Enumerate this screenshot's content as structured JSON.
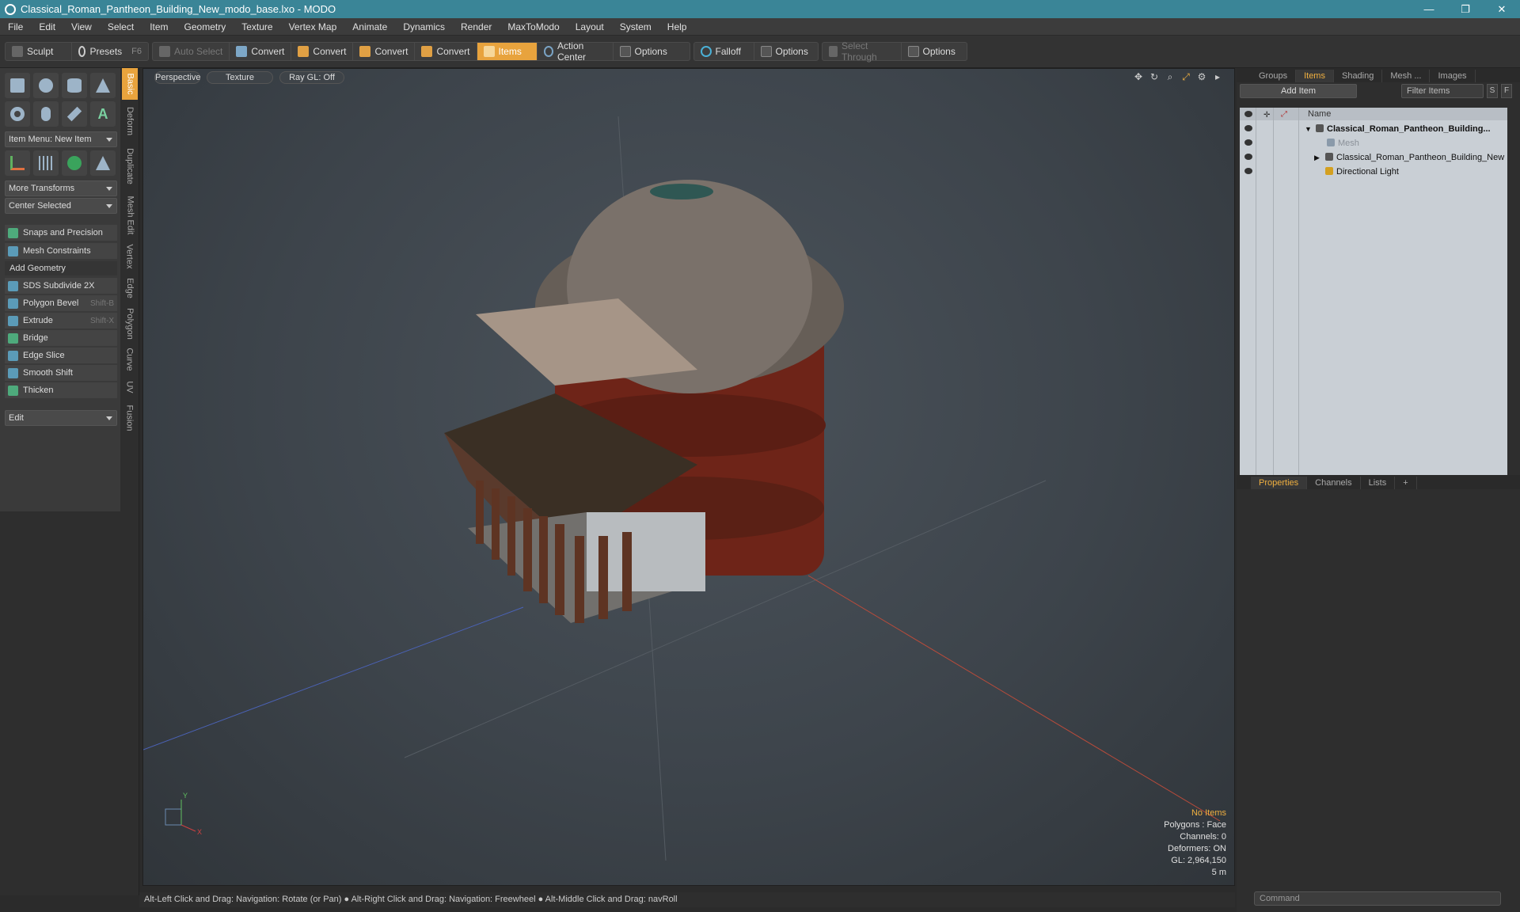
{
  "window": {
    "title": "Classical_Roman_Pantheon_Building_New_modo_base.lxo - MODO",
    "minimize": "—",
    "maximize": "❐",
    "close": "✕"
  },
  "menu": [
    "File",
    "Edit",
    "View",
    "Select",
    "Item",
    "Geometry",
    "Texture",
    "Vertex Map",
    "Animate",
    "Dynamics",
    "Render",
    "MaxToModo",
    "Layout",
    "System",
    "Help"
  ],
  "toolbar": {
    "sculpt": "Sculpt",
    "presets": "Presets",
    "presets_key": "F6",
    "auto_select": "Auto Select",
    "convert": "Convert",
    "items": "Items",
    "action_center": "Action Center",
    "options": "Options",
    "falloff": "Falloff",
    "select_through": "Select Through"
  },
  "left": {
    "tabs": [
      "Basic",
      "Deform",
      "Duplicate",
      "Mesh Edit",
      "Vertex",
      "Edge",
      "Polygon",
      "Curve",
      "UV",
      "Fusion"
    ],
    "item_menu": "Item Menu: New Item",
    "more_transforms": "More Transforms",
    "center_selected": "Center Selected",
    "snaps": "Snaps and Precision",
    "mesh_constraints": "Mesh Constraints",
    "add_geometry": "Add Geometry",
    "tools": [
      {
        "label": "SDS Subdivide 2X",
        "key": ""
      },
      {
        "label": "Polygon Bevel",
        "key": "Shift-B"
      },
      {
        "label": "Extrude",
        "key": "Shift-X"
      },
      {
        "label": "Bridge",
        "key": ""
      },
      {
        "label": "Edge Slice",
        "key": ""
      },
      {
        "label": "Smooth Shift",
        "key": ""
      },
      {
        "label": "Thicken",
        "key": ""
      }
    ],
    "edit": "Edit"
  },
  "viewport": {
    "tabs": [
      "Perspective",
      "Texture",
      "Ray GL: Off"
    ],
    "stats": {
      "items": "No Items",
      "polygons": "Polygons : Face",
      "channels": "Channels: 0",
      "deformers": "Deformers: ON",
      "gl": "GL: 2,964,150",
      "scale": "5 m"
    },
    "axis_x": "X",
    "axis_y": "Y"
  },
  "status": "Alt-Left Click and Drag: Navigation: Rotate (or Pan) ● Alt-Right Click and Drag: Navigation: Freewheel ● Alt-Middle Click and Drag: navRoll",
  "right": {
    "tabs": [
      "Groups",
      "Items",
      "Shading",
      "Mesh ...",
      "Images"
    ],
    "add_item": "Add Item",
    "filter": "Filter Items",
    "s_btn": "S",
    "f_btn": "F",
    "name_col": "Name",
    "rows": [
      "Classical_Roman_Pantheon_Building...",
      "Mesh",
      "Classical_Roman_Pantheon_Building_New",
      "Directional Light"
    ],
    "props_tabs": [
      "Properties",
      "Channels",
      "Lists"
    ],
    "command": "Command"
  }
}
